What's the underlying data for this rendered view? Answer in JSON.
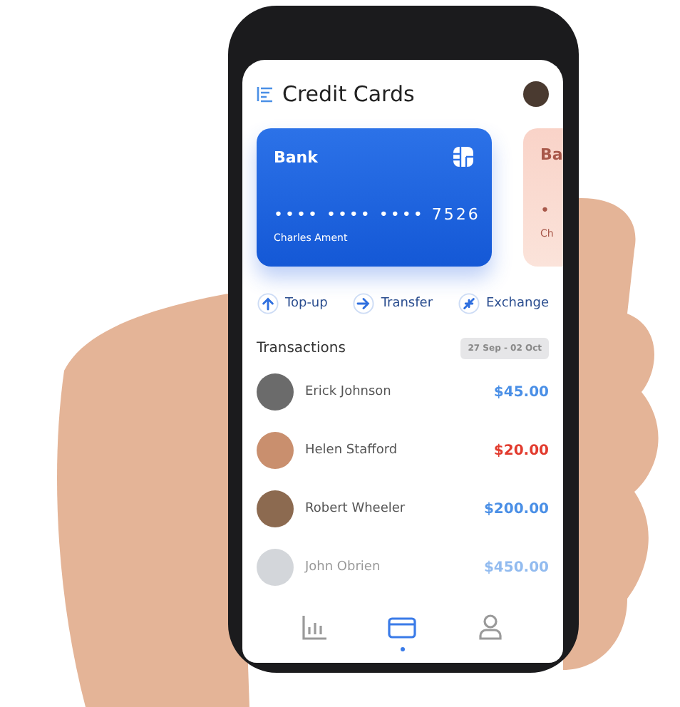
{
  "header": {
    "title": "Credit Cards"
  },
  "cards": [
    {
      "bank": "Bank",
      "number": "•••• •••• •••• 7526",
      "holder": "Charles Ament",
      "selected": true
    },
    {
      "bank": "Ba",
      "number": "•",
      "holder": "Ch",
      "selected": false
    }
  ],
  "actions": [
    {
      "label": "Top-up",
      "kind": "up"
    },
    {
      "label": "Transfer",
      "kind": "right"
    },
    {
      "label": "Exchange",
      "kind": "swap"
    }
  ],
  "transactions": {
    "title": "Transactions",
    "range": "27 Sep - 02 Oct",
    "rows": [
      {
        "name": "Erick Johnson",
        "amount": "$45.00",
        "kind": "in",
        "faded": false
      },
      {
        "name": "Helen Stafford",
        "amount": "$20.00",
        "kind": "out",
        "faded": false
      },
      {
        "name": "Robert Wheeler",
        "amount": "$200.00",
        "kind": "in",
        "faded": false
      },
      {
        "name": "John Obrien",
        "amount": "$450.00",
        "kind": "in",
        "faded": true
      }
    ]
  },
  "nav": [
    {
      "kind": "chart",
      "selected": false
    },
    {
      "kind": "card",
      "selected": true
    },
    {
      "kind": "user",
      "selected": false
    }
  ]
}
